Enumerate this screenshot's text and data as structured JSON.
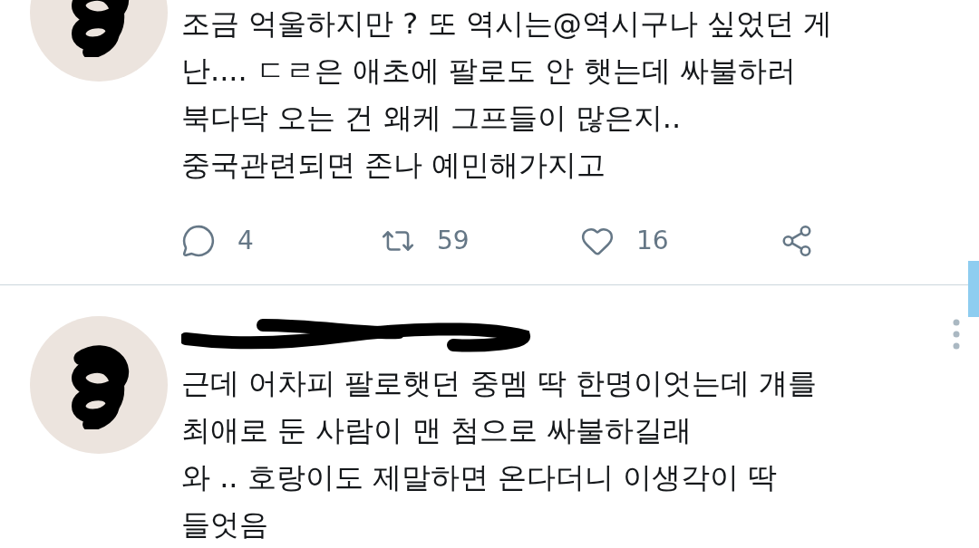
{
  "tweets": [
    {
      "redacted_header": false,
      "text_lines": [
        "조금 억울하지만 ? 또 역시는@역시구나 싶었던 게",
        "난.... ㄷㄹ은 애초에 팔로도 안 햇는데 싸불하러",
        "북다닥 오는 건 왜케 그프들이 많은지..",
        "중국관련되면 존나 예민해가지고"
      ],
      "actions": [
        {
          "kind": "reply",
          "count": "4"
        },
        {
          "kind": "retweet",
          "count": "59"
        },
        {
          "kind": "like",
          "count": "16"
        },
        {
          "kind": "share"
        }
      ]
    },
    {
      "redacted_header": true,
      "text_lines": [
        "근데 어차피 팔로햇던 중멤 딱 한명이엇는데 걔를",
        "최애로 둔 사람이 맨 첨으로 싸불하길래",
        "와 .. 호랑이도 제말하면 온다더니 이생각이 딱",
        "들엇음"
      ]
    }
  ]
}
